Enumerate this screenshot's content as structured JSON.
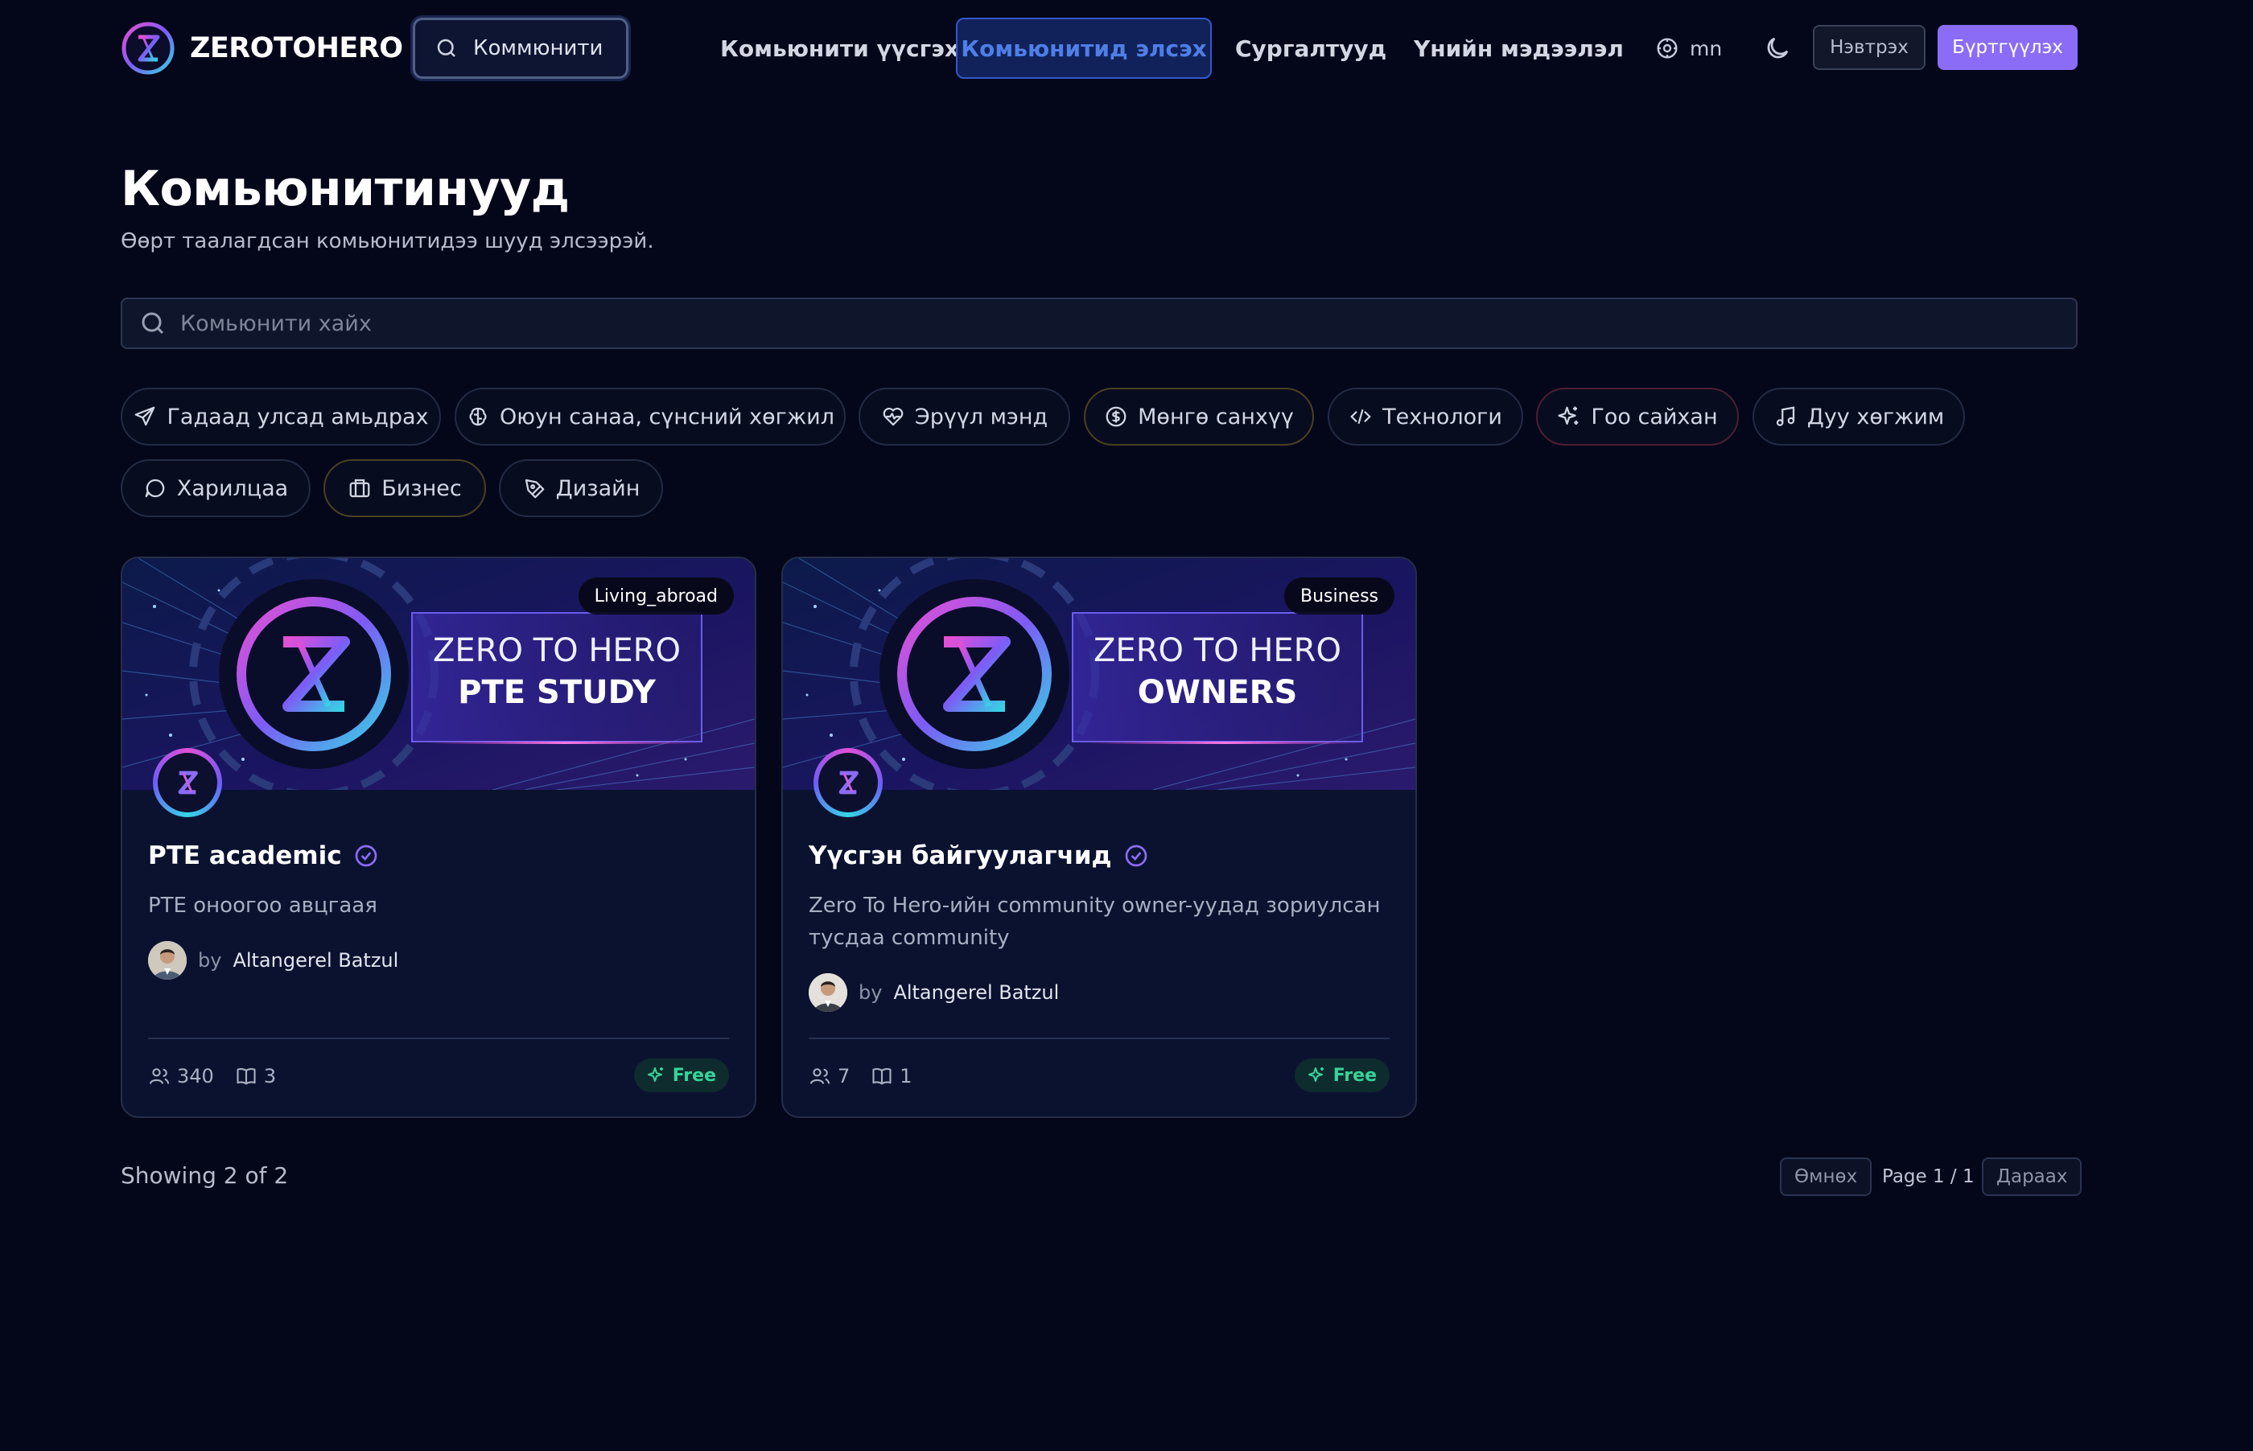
{
  "brand": {
    "name": "ZEROTOHERO"
  },
  "header": {
    "search_value": "Коммюнити",
    "nav": [
      {
        "label": "Комьюнити үүсгэх"
      },
      {
        "label": "Комьюнитид элсэх"
      },
      {
        "label": "Сургалтууд"
      },
      {
        "label": "Үнийн мэдээлэл"
      }
    ],
    "lang": "mn",
    "login_label": "Нэвтрэх",
    "signup_label": "Бүртгүүлэх"
  },
  "page": {
    "title": "Комьюнитинууд",
    "subtitle": "Өөрт таалагдсан комьюнитидээ шууд элсээрэй.",
    "search_placeholder": "Комьюнити хайх"
  },
  "categories": [
    {
      "label": "Гадаад улсад амьдрах",
      "icon": "plane-icon"
    },
    {
      "label": "Оюун санаа, сүнсний хөгжил",
      "icon": "brain-icon"
    },
    {
      "label": "Эрүүл мэнд",
      "icon": "heart-pulse-icon"
    },
    {
      "label": "Мөнгө санхүү",
      "icon": "dollar-icon"
    },
    {
      "label": "Технологи",
      "icon": "code-icon"
    },
    {
      "label": "Гоо сайхан",
      "icon": "sparkles-icon"
    },
    {
      "label": "Дуу хөгжим",
      "icon": "music-icon"
    },
    {
      "label": "Харилцаа",
      "icon": "chat-icon"
    },
    {
      "label": "Бизнес",
      "icon": "briefcase-icon"
    },
    {
      "label": "Дизайн",
      "icon": "pen-tool-icon"
    }
  ],
  "communities": [
    {
      "badge": "Living_abroad",
      "banner_line1": "ZERO TO HERO",
      "banner_line2": "PTE STUDY",
      "name": "PTE academic",
      "description": "PTE оноогоо авцгаая",
      "author_prefix": "by",
      "author": "Altangerel Batzul",
      "members": "340",
      "courses": "3",
      "price": "Free"
    },
    {
      "badge": "Business",
      "banner_line1": "ZERO TO HERO",
      "banner_line2": "OWNERS",
      "name": "Үүсгэн байгуулагчид",
      "description": "Zero To Hero-ийн community owner-уудад зориулсан тусдаа community",
      "author_prefix": "by",
      "author": "Altangerel Batzul",
      "members": "7",
      "courses": "1",
      "price": "Free"
    }
  ],
  "pagination": {
    "showing": "Showing 2 of 2",
    "prev": "Өмнөх",
    "page_info": "Page 1 / 1",
    "next": "Дараах"
  },
  "colors": {
    "accent": "#8b6cf6",
    "background": "#04061a",
    "card": "#0b1230",
    "free": "#37d39a"
  }
}
